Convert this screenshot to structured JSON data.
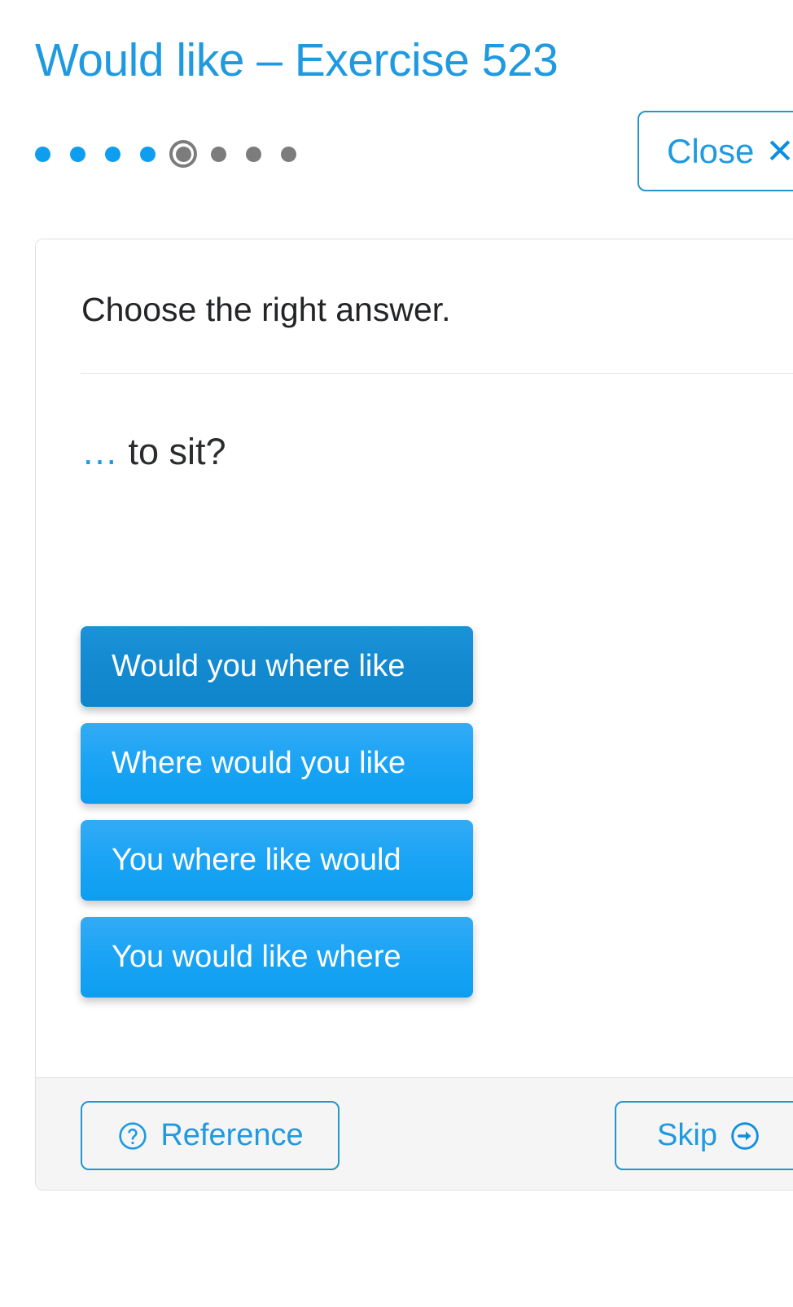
{
  "header": {
    "title": "Would like – Exercise 523",
    "title_color": "#1f9ae0",
    "close_label": "Close",
    "close_icon_glyph": "✕"
  },
  "progress": {
    "total_steps": 8,
    "current_step": 5,
    "completed_color": "#0d9ef0",
    "pending_color": "#7c7c7c",
    "steps": [
      {
        "state": "done"
      },
      {
        "state": "done"
      },
      {
        "state": "done"
      },
      {
        "state": "done"
      },
      {
        "state": "current"
      },
      {
        "state": "todo"
      },
      {
        "state": "todo"
      },
      {
        "state": "todo"
      }
    ]
  },
  "exercise": {
    "instruction": "Choose the right answer.",
    "blank": "…",
    "sentence_rest": " to sit?",
    "options": [
      {
        "label": "Would you where like",
        "state": "active"
      },
      {
        "label": "Where would you like",
        "state": "default"
      },
      {
        "label": "You where like would",
        "state": "default"
      },
      {
        "label": "You would like where",
        "state": "default"
      }
    ],
    "option_color": "#0d9ef0",
    "option_active_color": "#0f86cc"
  },
  "footer": {
    "reference_label": "Reference",
    "reference_icon": "question-circle-icon",
    "skip_label": "Skip",
    "skip_icon": "arrow-right-circle-icon",
    "accent_color": "#1f9ae0"
  }
}
